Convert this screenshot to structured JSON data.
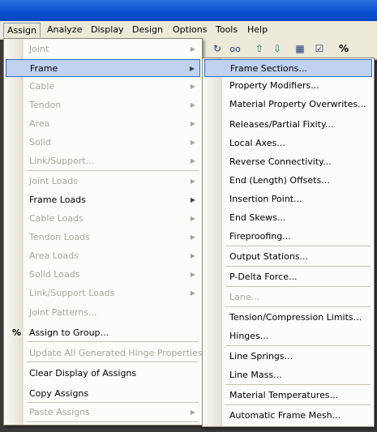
{
  "menubar": [
    "Assign",
    "Analyze",
    "Display",
    "Design",
    "Options",
    "Tools",
    "Help"
  ],
  "assign_menu": [
    {
      "label": "Joint",
      "disabled": true,
      "arrow": true
    },
    {
      "label": "Frame",
      "disabled": false,
      "arrow": true,
      "highlight": true
    },
    {
      "label": "Cable",
      "disabled": true,
      "arrow": true
    },
    {
      "label": "Tendon",
      "disabled": true,
      "arrow": true
    },
    {
      "label": "Area",
      "disabled": true,
      "arrow": true
    },
    {
      "label": "Solid",
      "disabled": true,
      "arrow": true
    },
    {
      "label": "Link/Support...",
      "disabled": true,
      "arrow": true
    },
    {
      "label": "Joint Loads",
      "disabled": true,
      "arrow": true
    },
    {
      "label": "Frame Loads",
      "disabled": false,
      "arrow": true
    },
    {
      "label": "Cable Loads",
      "disabled": true,
      "arrow": true
    },
    {
      "label": "Tendon Loads",
      "disabled": true,
      "arrow": true
    },
    {
      "label": "Area Loads",
      "disabled": true,
      "arrow": true
    },
    {
      "label": "Solid Loads",
      "disabled": true,
      "arrow": true
    },
    {
      "label": "Link/Support Loads",
      "disabled": true,
      "arrow": true
    },
    {
      "label": "Joint Patterns...",
      "disabled": true,
      "arrow": false
    },
    {
      "label": "Assign to Group...",
      "disabled": false,
      "arrow": false,
      "icon": "assign-group-icon"
    },
    {
      "label": "Update All Generated Hinge Properties",
      "disabled": true,
      "arrow": false
    },
    {
      "label": "Clear Display of Assigns",
      "disabled": false,
      "arrow": false
    },
    {
      "label": "Copy Assigns",
      "disabled": false,
      "arrow": false
    },
    {
      "label": "Paste Assigns",
      "disabled": true,
      "arrow": true
    }
  ],
  "frame_submenu": [
    {
      "label": "Frame Sections...",
      "disabled": false,
      "highlight": true
    },
    {
      "label": "Property Modifiers...",
      "disabled": false
    },
    {
      "label": "Material Property Overwrites...",
      "disabled": false
    },
    {
      "label": "Releases/Partial Fixity...",
      "disabled": false
    },
    {
      "label": "Local Axes...",
      "disabled": false
    },
    {
      "label": "Reverse Connectivity...",
      "disabled": false
    },
    {
      "label": "End (Length) Offsets...",
      "disabled": false
    },
    {
      "label": "Insertion Point...",
      "disabled": false
    },
    {
      "label": "End Skews...",
      "disabled": false
    },
    {
      "label": "Fireproofing...",
      "disabled": false
    },
    {
      "label": "Output Stations...",
      "disabled": false
    },
    {
      "label": "P-Delta Force...",
      "disabled": false
    },
    {
      "label": "Lane...",
      "disabled": true
    },
    {
      "label": "Tension/Compression Limits...",
      "disabled": false
    },
    {
      "label": "Hinges...",
      "disabled": false
    },
    {
      "label": "Line Springs...",
      "disabled": false
    },
    {
      "label": "Line Mass...",
      "disabled": false
    },
    {
      "label": "Material Temperatures...",
      "disabled": false
    },
    {
      "label": "Automatic Frame Mesh...",
      "disabled": false
    }
  ],
  "toolbar_icons": [
    "refresh-icon",
    "glasses-icon",
    "arrow-up-icon",
    "arrow-down-icon",
    "select-icon",
    "checkbox-icon",
    "assign-icon"
  ]
}
